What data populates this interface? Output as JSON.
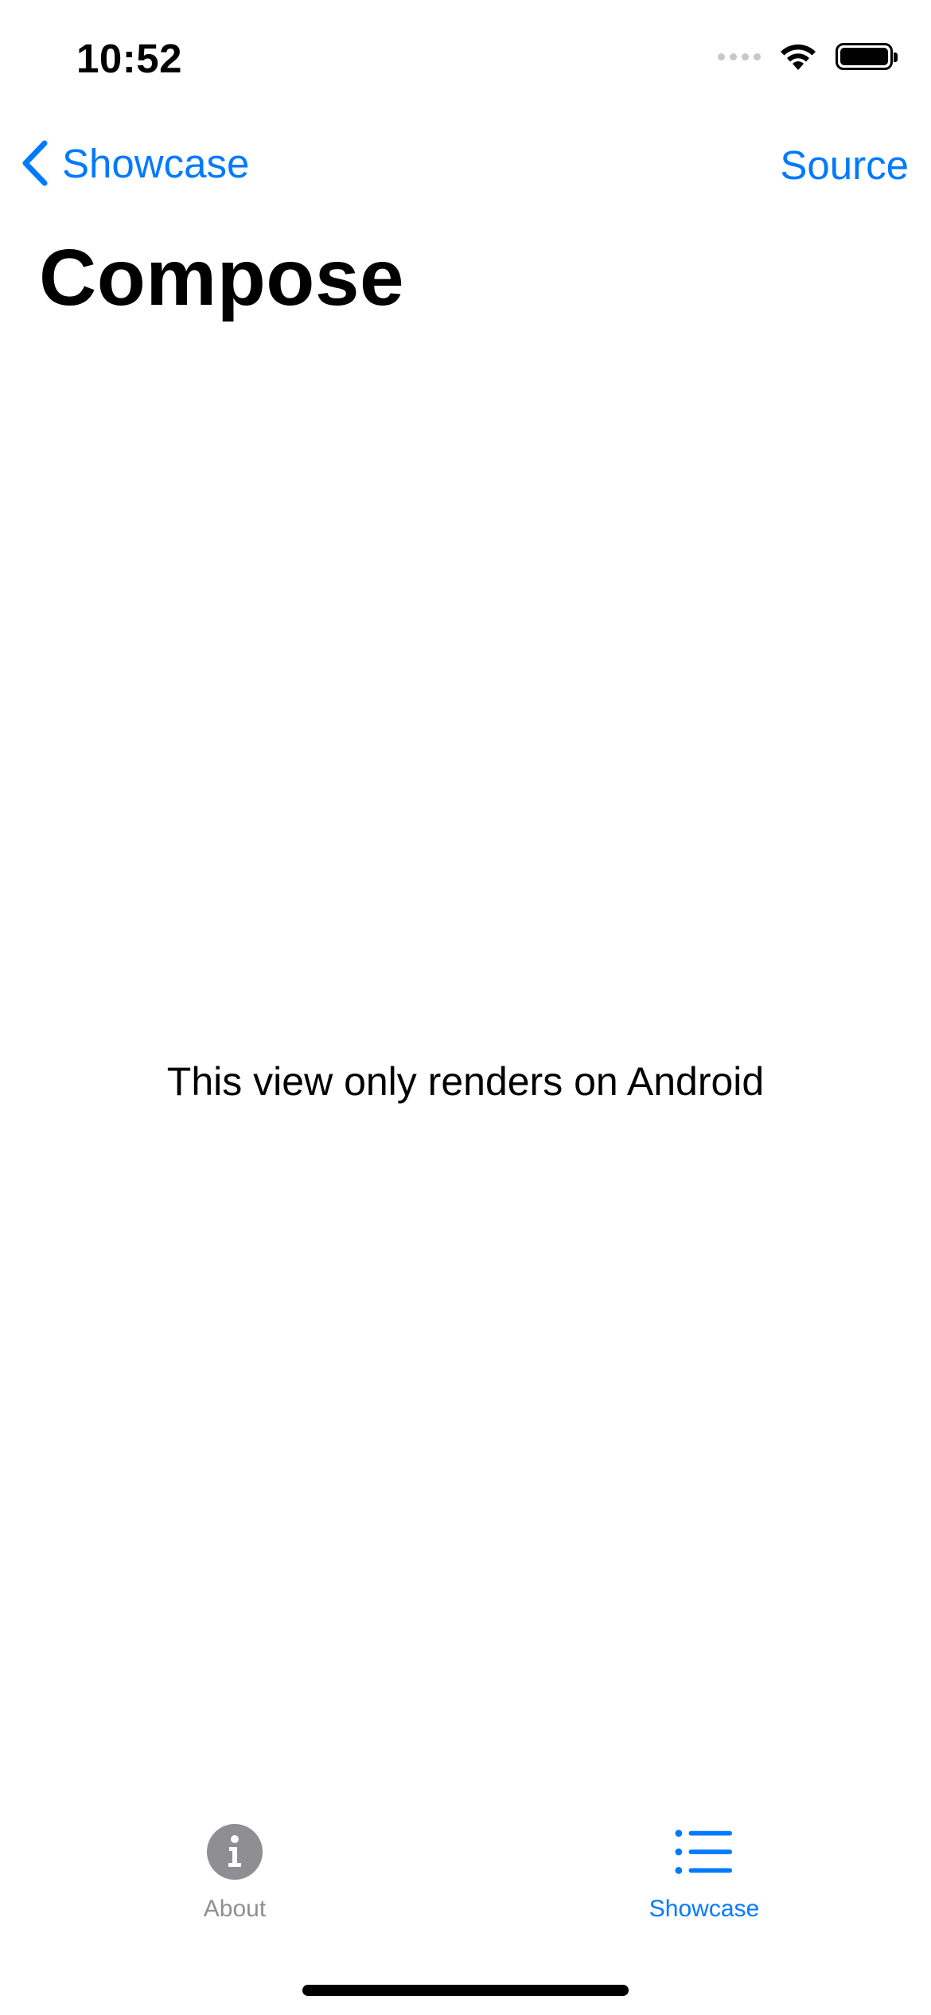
{
  "status_bar": {
    "time": "10:52"
  },
  "nav": {
    "back_label": "Showcase",
    "action_label": "Source",
    "title": "Compose"
  },
  "content": {
    "message": "This view only renders on Android"
  },
  "tab_bar": {
    "tabs": [
      {
        "label": "About",
        "icon": "info-icon",
        "selected": false
      },
      {
        "label": "Showcase",
        "icon": "list-icon",
        "selected": true
      }
    ]
  },
  "colors": {
    "accent": "#007aff",
    "inactive": "#8e8e93",
    "background": "#ffffff"
  }
}
